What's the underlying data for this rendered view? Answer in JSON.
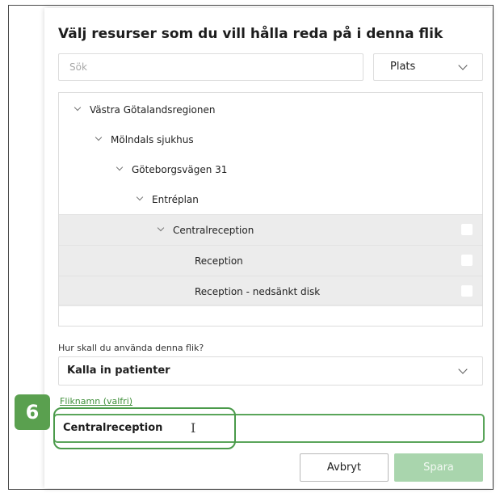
{
  "dialog": {
    "title": "Välj resurser som du vill hålla reda på i denna flik",
    "search_placeholder": "Sök",
    "location_select": "Plats"
  },
  "tree": [
    {
      "label": "Västra Götalandsregionen",
      "expandable": true,
      "selected": false
    },
    {
      "label": "Mölndals sjukhus",
      "expandable": true,
      "selected": false
    },
    {
      "label": "Göteborgsvägen 31",
      "expandable": true,
      "selected": false
    },
    {
      "label": "Entréplan",
      "expandable": true,
      "selected": false
    },
    {
      "label": "Centralreception",
      "expandable": true,
      "selected": true
    },
    {
      "label": "Reception",
      "expandable": false,
      "selected": true
    },
    {
      "label": "Reception - nedsänkt disk",
      "expandable": false,
      "selected": true
    }
  ],
  "usage": {
    "question": "Hur skall du använda denna flik?",
    "value": "Kalla in patienter"
  },
  "tab_name": {
    "label": "Fliknamn (valfri)",
    "value": "Centralreception"
  },
  "step_badge": "6",
  "buttons": {
    "cancel": "Avbryt",
    "save": "Spara"
  },
  "colors": {
    "accent_green": "#5aa04f",
    "save_disabled": "#a9d5ad",
    "selected_row": "#ececec"
  }
}
